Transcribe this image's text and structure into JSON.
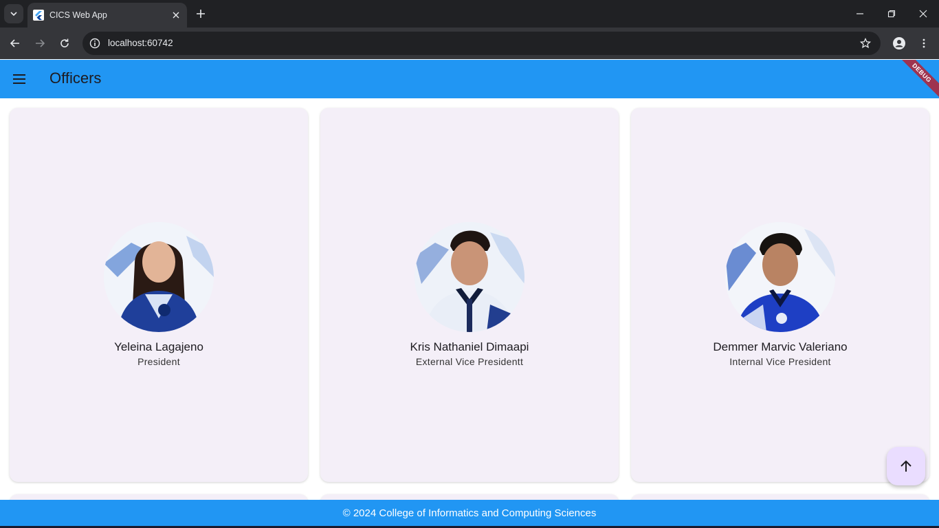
{
  "browser": {
    "tab_title": "CICS Web App",
    "url": "localhost:60742"
  },
  "appbar": {
    "title": "Officers",
    "debug_label": "DEBUG",
    "color": "#2196f3"
  },
  "officers": [
    {
      "name": "Yeleina Lagajeno",
      "role": "President"
    },
    {
      "name": "Kris Nathaniel Dimaapi",
      "role": "External Vice Presidentt"
    },
    {
      "name": "Demmer Marvic Valeriano",
      "role": "Internal Vice President"
    }
  ],
  "footer": {
    "text": "© 2024 College of Informatics and Computing Sciences"
  },
  "icons": {
    "fab": "arrow-up-icon",
    "menu": "menu-icon"
  }
}
